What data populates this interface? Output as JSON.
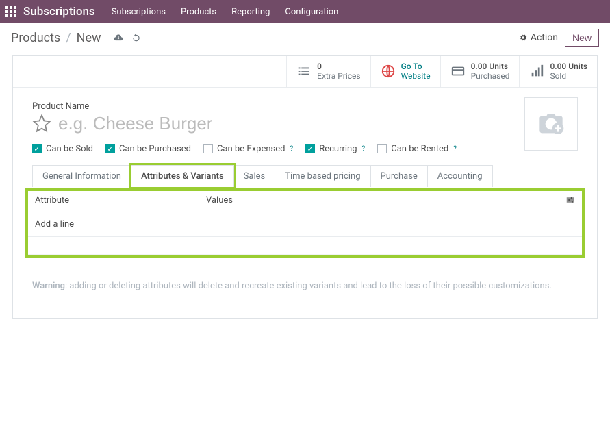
{
  "topbar": {
    "title": "Subscriptions",
    "menu": [
      "Subscriptions",
      "Products",
      "Reporting",
      "Configuration"
    ]
  },
  "breadcrumb": {
    "parent": "Products",
    "current": "New"
  },
  "cp": {
    "action_label": "Action",
    "new_label": "New"
  },
  "stats": {
    "extra_prices": {
      "num": "0",
      "lbl": "Extra Prices"
    },
    "website": {
      "num": "Go To",
      "lbl": "Website"
    },
    "purchased": {
      "num": "0.00 Units",
      "lbl": "Purchased"
    },
    "sold": {
      "num": "0.00 Units",
      "lbl": "Sold"
    }
  },
  "form": {
    "name_label": "Product Name",
    "name_placeholder": "e.g. Cheese Burger",
    "options": {
      "can_be_sold": "Can be Sold",
      "can_be_purchased": "Can be Purchased",
      "can_be_expensed": "Can be Expensed",
      "recurring": "Recurring",
      "can_be_rented": "Can be Rented"
    }
  },
  "tabs": {
    "general": "General Information",
    "attributes": "Attributes & Variants",
    "sales": "Sales",
    "time_pricing": "Time based pricing",
    "purchase": "Purchase",
    "accounting": "Accounting"
  },
  "table": {
    "attribute_header": "Attribute",
    "values_header": "Values",
    "add_line": "Add a line"
  },
  "warning": {
    "prefix": "Warning",
    "text": ": adding or deleting attributes will delete and recreate existing variants and lead to the loss of their possible customizations."
  }
}
